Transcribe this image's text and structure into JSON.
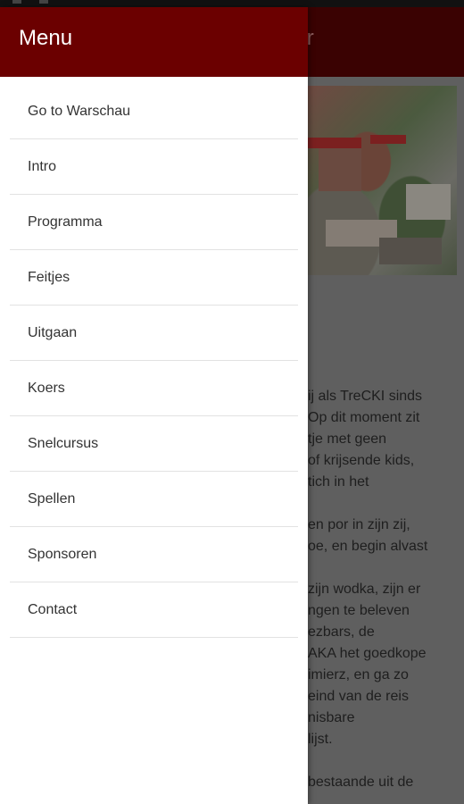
{
  "app_bar": {
    "title_fragment": "ner"
  },
  "drawer": {
    "title": "Menu",
    "items": [
      {
        "label": "Go to Warschau"
      },
      {
        "label": "Intro"
      },
      {
        "label": "Programma"
      },
      {
        "label": "Feitjes"
      },
      {
        "label": "Uitgaan"
      },
      {
        "label": "Koers"
      },
      {
        "label": "Snelcursus"
      },
      {
        "label": "Spellen"
      },
      {
        "label": "Sponsoren"
      },
      {
        "label": "Contact"
      }
    ]
  },
  "background_text": {
    "lines": [
      "ij als TreCKI sinds",
      "Op dit moment zit",
      "tje met geen",
      "of krijsende kids,",
      "tich in het",
      "",
      "en por in zijn zij,",
      "oe, en begin alvast",
      "",
      "zijn wodka, zijn er",
      "ngen te beleven",
      "ezbars, de",
      "AKA het goedkope",
      "imierz, en ga zo",
      "eind van de reis",
      "nisbare",
      " lijst.",
      "",
      "bestaande uit de"
    ]
  }
}
